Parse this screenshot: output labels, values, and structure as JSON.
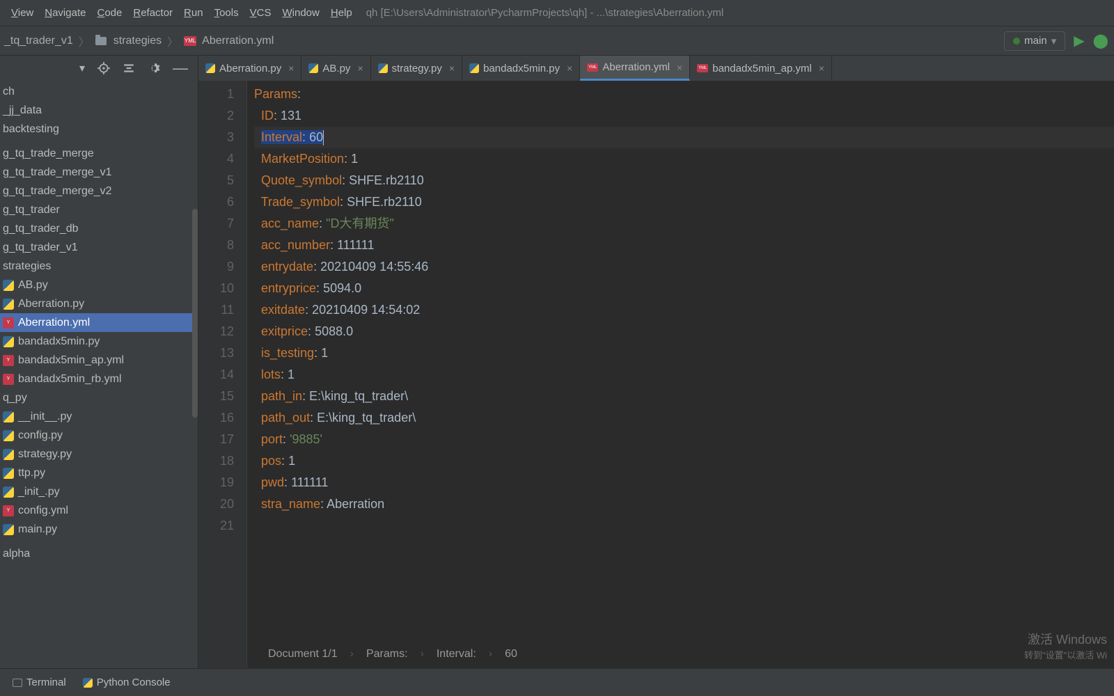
{
  "menubar": {
    "items": [
      "View",
      "Navigate",
      "Code",
      "Refactor",
      "Run",
      "Tools",
      "VCS",
      "Window",
      "Help"
    ],
    "titlepath": "qh [E:\\Users\\Administrator\\PycharmProjects\\qh] - ...\\strategies\\Aberration.yml"
  },
  "breadcrumb": {
    "items": [
      "_tq_trader_v1",
      "strategies",
      "Aberration.yml"
    ]
  },
  "toolbar": {
    "run_config": "main"
  },
  "sidebar_items": [
    {
      "label": "ch",
      "icon": "dir"
    },
    {
      "label": "_jj_data",
      "icon": "dir"
    },
    {
      "label": "backtesting",
      "icon": "dir"
    },
    {
      "label": "",
      "icon": "gap"
    },
    {
      "label": "g_tq_trade_merge",
      "icon": "dir"
    },
    {
      "label": "g_tq_trade_merge_v1",
      "icon": "dir"
    },
    {
      "label": "g_tq_trade_merge_v2",
      "icon": "dir"
    },
    {
      "label": "g_tq_trader",
      "icon": "dir"
    },
    {
      "label": "g_tq_trader_db",
      "icon": "dir"
    },
    {
      "label": "g_tq_trader_v1",
      "icon": "dir"
    },
    {
      "label": "strategies",
      "icon": "dir"
    },
    {
      "label": "AB.py",
      "icon": "py"
    },
    {
      "label": "Aberration.py",
      "icon": "py"
    },
    {
      "label": "Aberration.yml",
      "icon": "yml",
      "selected": true
    },
    {
      "label": "bandadx5min.py",
      "icon": "py"
    },
    {
      "label": "bandadx5min_ap.yml",
      "icon": "yml"
    },
    {
      "label": "bandadx5min_rb.yml",
      "icon": "yml"
    },
    {
      "label": "q_py",
      "icon": "dir"
    },
    {
      "label": "__init__.py",
      "icon": "py"
    },
    {
      "label": "config.py",
      "icon": "py"
    },
    {
      "label": "strategy.py",
      "icon": "py"
    },
    {
      "label": "ttp.py",
      "icon": "py"
    },
    {
      "label": "_init_.py",
      "icon": "py"
    },
    {
      "label": "config.yml",
      "icon": "yml"
    },
    {
      "label": "main.py",
      "icon": "py"
    },
    {
      "label": "",
      "icon": "gap"
    },
    {
      "label": "alpha",
      "icon": "dir"
    }
  ],
  "tabs": [
    {
      "label": "Aberration.py",
      "icon": "py"
    },
    {
      "label": "AB.py",
      "icon": "py"
    },
    {
      "label": "strategy.py",
      "icon": "py"
    },
    {
      "label": "bandadx5min.py",
      "icon": "py"
    },
    {
      "label": "Aberration.yml",
      "icon": "yml",
      "active": true
    },
    {
      "label": "bandadx5min_ap.yml",
      "icon": "yml"
    }
  ],
  "code": {
    "lines": [
      {
        "n": 1,
        "key": "Params",
        "colon": ":",
        "val": "",
        "indent": 0
      },
      {
        "n": 2,
        "key": "ID",
        "colon": ": ",
        "val": "131",
        "indent": 1
      },
      {
        "n": 3,
        "key": "Interval",
        "colon": ": ",
        "val": "60",
        "indent": 1,
        "selected": true
      },
      {
        "n": 4,
        "key": "MarketPosition",
        "colon": ": ",
        "val": "1",
        "indent": 1
      },
      {
        "n": 5,
        "key": "Quote_symbol",
        "colon": ": ",
        "val": "SHFE.rb2110",
        "indent": 1
      },
      {
        "n": 6,
        "key": "Trade_symbol",
        "colon": ": ",
        "val": "SHFE.rb2110",
        "indent": 1
      },
      {
        "n": 7,
        "key": "acc_name",
        "colon": ": ",
        "val": "\"D大有期货\"",
        "indent": 1,
        "string": true
      },
      {
        "n": 8,
        "key": "acc_number",
        "colon": ": ",
        "val": "111111",
        "indent": 1
      },
      {
        "n": 9,
        "key": "entrydate",
        "colon": ": ",
        "val": "20210409 14:55:46",
        "indent": 1
      },
      {
        "n": 10,
        "key": "entryprice",
        "colon": ": ",
        "val": "5094.0",
        "indent": 1
      },
      {
        "n": 11,
        "key": "exitdate",
        "colon": ": ",
        "val": "20210409 14:54:02",
        "indent": 1
      },
      {
        "n": 12,
        "key": "exitprice",
        "colon": ": ",
        "val": "5088.0",
        "indent": 1
      },
      {
        "n": 13,
        "key": "is_testing",
        "colon": ": ",
        "val": "1",
        "indent": 1
      },
      {
        "n": 14,
        "key": "lots",
        "colon": ": ",
        "val": "1",
        "indent": 1
      },
      {
        "n": 15,
        "key": "path_in",
        "colon": ": ",
        "val": "E:\\king_tq_trader\\",
        "indent": 1
      },
      {
        "n": 16,
        "key": "path_out",
        "colon": ": ",
        "val": "E:\\king_tq_trader\\",
        "indent": 1
      },
      {
        "n": 17,
        "key": "port",
        "colon": ": ",
        "val": "'9885'",
        "indent": 1,
        "string": true
      },
      {
        "n": 18,
        "key": "pos",
        "colon": ": ",
        "val": "1",
        "indent": 1
      },
      {
        "n": 19,
        "key": "pwd",
        "colon": ": ",
        "val": "111111",
        "indent": 1
      },
      {
        "n": 20,
        "key": "stra_name",
        "colon": ": ",
        "val": "Aberration",
        "indent": 1
      },
      {
        "n": 21,
        "key": "",
        "colon": "",
        "val": "",
        "indent": 0
      }
    ]
  },
  "status": {
    "doc": "Document 1/1",
    "p1": "Params:",
    "p2": "Interval:",
    "p3": "60"
  },
  "bottom_tools": {
    "terminal": "Terminal",
    "python_console": "Python Console"
  },
  "watermark": {
    "l1": "激活 Windows",
    "l2": "转到\"设置\"以激活 Wi"
  }
}
